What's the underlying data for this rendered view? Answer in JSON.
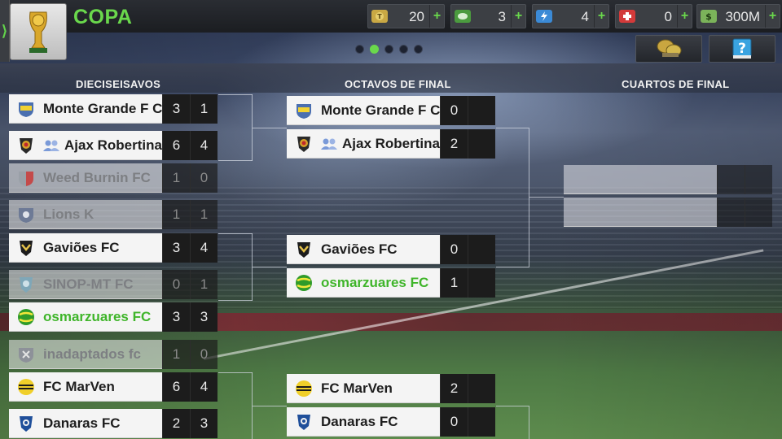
{
  "header": {
    "title": "COPA",
    "side_tab_glyph": "⟩"
  },
  "resources": [
    {
      "name": "tokens",
      "icon": "token-icon",
      "value": "20",
      "color": "#d8b64a"
    },
    {
      "name": "cash",
      "icon": "cash-icon",
      "value": "3",
      "color": "#56a845"
    },
    {
      "name": "energy",
      "icon": "energy-icon",
      "value": "4",
      "color": "#3e8ed8"
    },
    {
      "name": "health",
      "icon": "health-icon",
      "value": "0",
      "color": "#d23a3a"
    },
    {
      "name": "money",
      "icon": "money-icon",
      "value": "300M",
      "color": "#7bb35a"
    }
  ],
  "resource_plus": "+",
  "pager": {
    "total": 5,
    "active": 1
  },
  "rounds": [
    "DIECISEISAVOS",
    "OCTAVOS DE FINAL",
    "CUARTOS DE FINAL"
  ],
  "round_of_32": [
    {
      "team": "Monte Grande F C",
      "badge": "shield-yellow-icon",
      "leg1": "3",
      "leg2": "1",
      "dim": false
    },
    {
      "team": "Ajax Robertina",
      "badge": "crest-red-icon",
      "friend": true,
      "leg1": "6",
      "leg2": "4",
      "dim": false
    },
    {
      "team": "Weed Burnin FC",
      "badge": "shield-red-icon",
      "leg1": "1",
      "leg2": "0",
      "dim": true
    },
    {
      "team": "Lions K",
      "badge": "shield-blue-icon",
      "leg1": "1",
      "leg2": "1",
      "dim": true
    },
    {
      "team": "Gaviões FC",
      "badge": "crest-gold-icon",
      "leg1": "3",
      "leg2": "4",
      "dim": false
    },
    {
      "team": "SINOP-MT FC",
      "badge": "crest-teal-icon",
      "leg1": "0",
      "leg2": "1",
      "dim": true
    },
    {
      "team": "osmarzuares FC",
      "badge": "ball-green-icon",
      "leg1": "3",
      "leg2": "3",
      "dim": false,
      "own": true
    },
    {
      "team": "inadaptados fc",
      "badge": "shield-grey-icon",
      "leg1": "1",
      "leg2": "0",
      "dim": true
    },
    {
      "team": "FC MarVen",
      "badge": "ball-yellow-icon",
      "leg1": "6",
      "leg2": "4",
      "dim": false
    },
    {
      "team": "Danaras FC",
      "badge": "crest-blue-icon",
      "leg1": "2",
      "leg2": "3",
      "dim": false
    }
  ],
  "round_of_16": [
    {
      "team": "Monte Grande F C",
      "badge": "shield-yellow-icon",
      "leg1": "0",
      "leg2": ""
    },
    {
      "team": "Ajax Robertina",
      "badge": "crest-red-icon",
      "friend": true,
      "leg1": "2",
      "leg2": ""
    },
    {
      "team": "Gaviões FC",
      "badge": "crest-gold-icon",
      "leg1": "0",
      "leg2": ""
    },
    {
      "team": "osmarzuares FC",
      "badge": "ball-green-icon",
      "leg1": "1",
      "leg2": "",
      "own": true
    },
    {
      "team": "FC MarVen",
      "badge": "ball-yellow-icon",
      "leg1": "2",
      "leg2": ""
    },
    {
      "team": "Danaras FC",
      "badge": "crest-blue-icon",
      "leg1": "0",
      "leg2": ""
    }
  ]
}
